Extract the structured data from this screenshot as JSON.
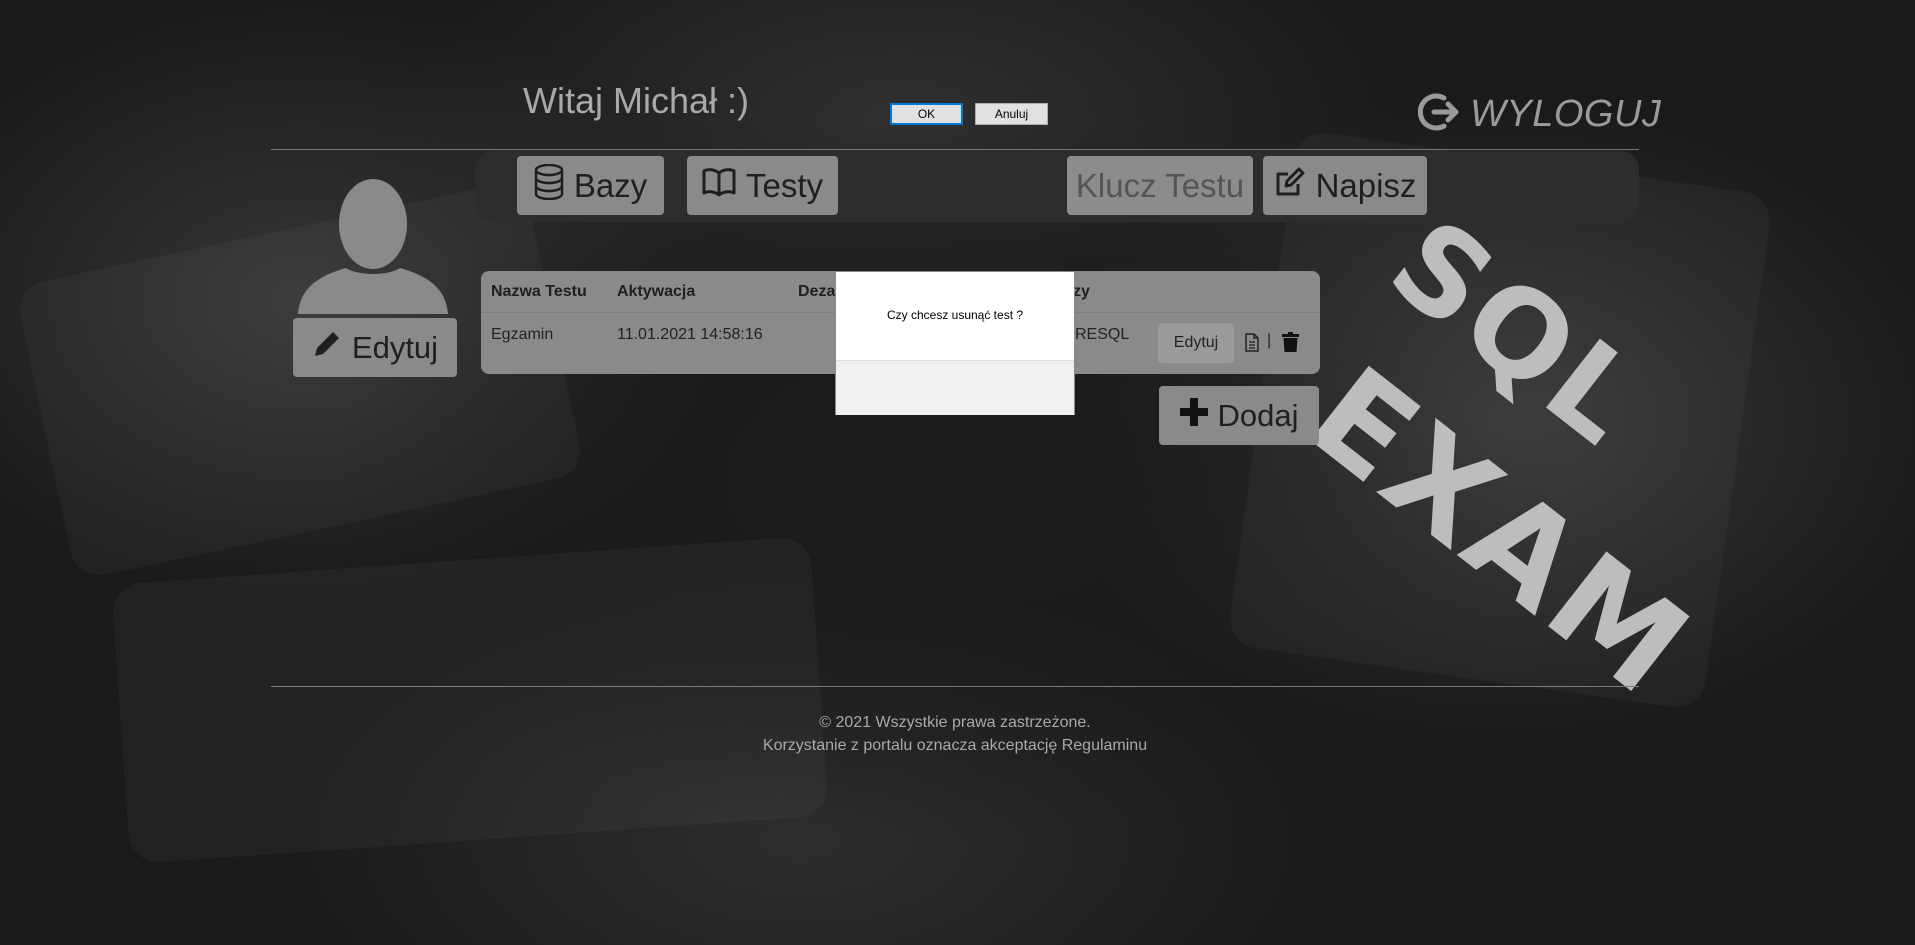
{
  "header": {
    "welcome": "Witaj Michał :)",
    "logout_label": "WYLOGUJ"
  },
  "nav": {
    "bazy": "Bazy",
    "testy": "Testy",
    "klucz_testu": "Klucz Testu",
    "napisz": "Napisz"
  },
  "profile": {
    "edit_label": "Edytuj"
  },
  "table": {
    "headers": [
      "Nazwa Testu",
      "Aktywacja",
      "Deza",
      "zy"
    ],
    "rows": [
      {
        "name": "Egzamin",
        "activation": "11.01.2021 14:58:16",
        "db": "RESQL",
        "edit_label": "Edytuj",
        "separator": "|"
      }
    ]
  },
  "add_button": "Dodaj",
  "logo": {
    "line1": "SQL",
    "line2": "EXAM"
  },
  "footer": {
    "line1": "© 2021 Wszystkie prawa zastrzeżone.",
    "line2": "Korzystanie z portalu oznacza akceptację Regulaminu"
  },
  "dialog": {
    "message": "Czy chcesz usunąć test ?",
    "ok_label": "OK",
    "cancel_label": "Anuluj"
  },
  "icons": {
    "logout": "logout-icon",
    "database": "database-icon",
    "book": "book-icon",
    "edit": "pencil-square-icon",
    "pencil": "pencil-icon",
    "avatar": "user-silhouette-icon",
    "document": "document-icon",
    "trash": "trash-icon",
    "plus": "plus-icon"
  }
}
